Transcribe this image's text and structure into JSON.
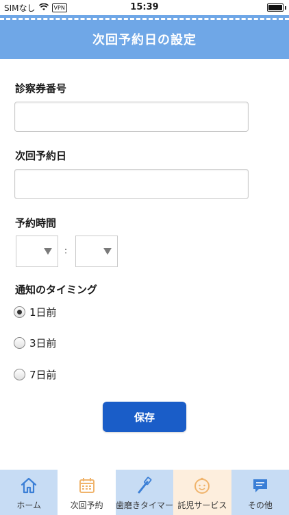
{
  "status_bar": {
    "carrier": "SIMなし",
    "vpn": "VPN",
    "time": "15:39"
  },
  "header": {
    "title": "次回予約日の設定"
  },
  "form": {
    "card_number_label": "診察券番号",
    "card_number_value": "",
    "next_date_label": "次回予約日",
    "next_date_value": "",
    "time_label": "予約時間",
    "time_separator": ":",
    "notify_label": "通知のタイミング",
    "options": [
      {
        "label": "1日前",
        "selected": true
      },
      {
        "label": "3日前",
        "selected": false
      },
      {
        "label": "7日前",
        "selected": false
      }
    ],
    "save_label": "保存"
  },
  "tabs": [
    {
      "label": "ホーム",
      "icon": "home-icon",
      "bg": "#c7dcf4"
    },
    {
      "label": "次回予約",
      "icon": "calendar-icon",
      "bg": "#ffffff"
    },
    {
      "label": "歯磨きタイマー",
      "icon": "toothbrush-icon",
      "bg": "#c7dcf4"
    },
    {
      "label": "託児サービス",
      "icon": "baby-face-icon",
      "bg": "#fdeedd"
    },
    {
      "label": "その他",
      "icon": "chat-icon",
      "bg": "#c7dcf4"
    }
  ],
  "colors": {
    "header": "#6fa7e7",
    "button": "#1a5dc8",
    "icon_blue": "#3b7fd6",
    "icon_orange": "#f0b46c"
  }
}
